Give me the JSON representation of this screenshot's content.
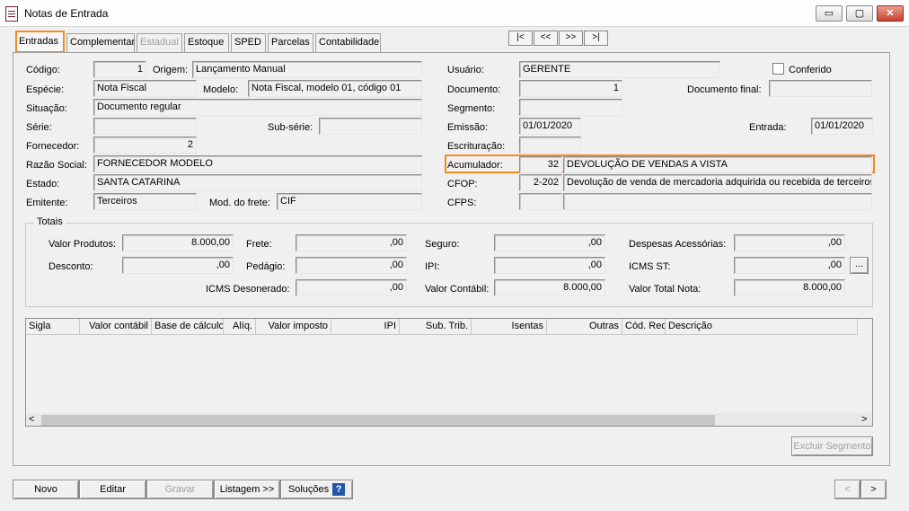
{
  "window": {
    "title": "Notas de Entrada",
    "min": "▭",
    "max": "▢",
    "close": "✕"
  },
  "tabs": {
    "entradas": "Entradas",
    "complementar": "Complementar",
    "estadual": "Estadual",
    "estoque": "Estoque",
    "sped": "SPED",
    "parcelas": "Parcelas",
    "contabilidade": "Contabilidade"
  },
  "nav": {
    "first": "|<",
    "prev": "<<",
    "next": ">>",
    "last": ">|"
  },
  "form": {
    "codigo_label": "Código:",
    "codigo": "1",
    "origem_label": "Origem:",
    "origem": "Lançamento Manual",
    "usuario_label": "Usuário:",
    "usuario": "GERENTE",
    "conferido_label": "Conferido",
    "especie_label": "Espécie:",
    "especie": "Nota Fiscal",
    "modelo_label": "Modelo:",
    "modelo": "Nota Fiscal, modelo 01, código 01",
    "documento_label": "Documento:",
    "documento": "1",
    "documento_final_label": "Documento final:",
    "documento_final": "",
    "situacao_label": "Situação:",
    "situacao": "Documento regular",
    "segmento_label": "Segmento:",
    "segmento": "",
    "serie_label": "Série:",
    "serie": "",
    "subserie_label": "Sub-série:",
    "subserie": "",
    "emissao_label": "Emissão:",
    "emissao": "01/01/2020",
    "entrada_label": "Entrada:",
    "entrada": "01/01/2020",
    "fornecedor_label": "Fornecedor:",
    "fornecedor": "2",
    "escrituracao_label": "Escrituração:",
    "escrituracao": "",
    "razao_label": "Razão Social:",
    "razao": "FORNECEDOR MODELO",
    "acumulador_label": "Acumulador:",
    "acumulador_cod": "32",
    "acumulador_desc": "DEVOLUÇÃO DE VENDAS A VISTA",
    "estado_label": "Estado:",
    "estado": "SANTA CATARINA",
    "cfop_label": "CFOP:",
    "cfop_cod": "2-202",
    "cfop_desc": "Devolução de venda de mercadoria adquirida ou recebida de terceiros",
    "emitente_label": "Emitente:",
    "emitente": "Terceiros",
    "frete_mod_label": "Mod. do frete:",
    "frete_mod": "CIF",
    "cfps_label": "CFPS:",
    "cfps_cod": "",
    "cfps_desc": ""
  },
  "totais": {
    "title": "Totais",
    "valor_produtos_label": "Valor Produtos:",
    "valor_produtos": "8.000,00",
    "frete_label": "Frete:",
    "frete": ",00",
    "seguro_label": "Seguro:",
    "seguro": ",00",
    "despesas_label": "Despesas Acessórias:",
    "despesas": ",00",
    "desconto_label": "Desconto:",
    "desconto": ",00",
    "pedagio_label": "Pedágio:",
    "pedagio": ",00",
    "ipi_label": "IPI:",
    "ipi": ",00",
    "icms_st_label": "ICMS ST:",
    "icms_st": ",00",
    "ellipsis": "...",
    "icms_des_label": "ICMS Desonerado:",
    "icms_des": ",00",
    "valor_contabil_label": "Valor Contábil:",
    "valor_contabil": "8.000,00",
    "valor_total_label": "Valor Total Nota:",
    "valor_total": "8.000,00"
  },
  "grid": {
    "columns": [
      "Sigla",
      "Valor contábil",
      "Base de cálculo",
      "Alíq.",
      "Valor imposto",
      "IPI",
      "Sub. Trib.",
      "Isentas",
      "Outras",
      "Cód. Rec.",
      "Descrição"
    ],
    "scroll_left": "<",
    "scroll_right": ">"
  },
  "buttons": {
    "excluir_segmento": "Excluir Segmento",
    "novo": "Novo",
    "editar": "Editar",
    "gravar": "Gravar",
    "listagem": "Listagem >>",
    "solucoes": "Soluções",
    "help": "?",
    "prev": "<",
    "next": ">"
  }
}
